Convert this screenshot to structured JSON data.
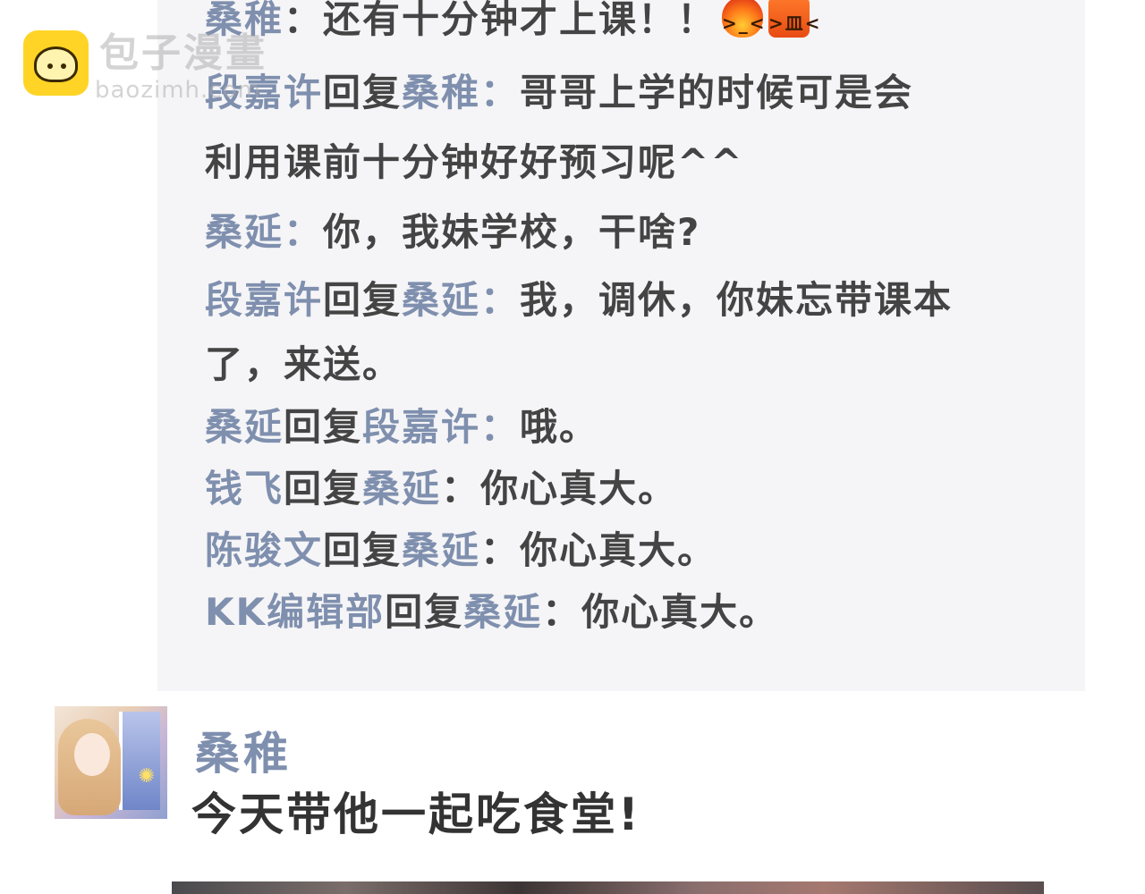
{
  "watermark": {
    "title": "包子漫畫",
    "subtitle": "baozimh.com",
    "icon": "bun-logo-icon"
  },
  "comments": [
    {
      "author": "桑稚",
      "separator": "：",
      "text": "还有十分钟才上课！！",
      "emojis": [
        "fire-angry-emoji",
        "angry-face-emoji"
      ]
    },
    {
      "author": "段嘉许",
      "reply_word": "回复",
      "reply_to": "桑稚：",
      "text": "哥哥上学的时候可是会",
      "text_cont": "利用课前十分钟好好预习呢^^"
    },
    {
      "author": "桑延：",
      "text": "你，我妹学校，干啥?"
    },
    {
      "author": "段嘉许",
      "reply_word": "回复",
      "reply_to": "桑延：",
      "text": "我，调休，你妹忘带课本",
      "text_cont": "了，来送。"
    },
    {
      "author": "桑延",
      "reply_word": "回复",
      "reply_to": "段嘉许：",
      "text": "哦。"
    },
    {
      "author": "钱飞",
      "reply_word": "回复",
      "reply_to": "桑延",
      "separator": "：",
      "text": "你心真大。"
    },
    {
      "author": "陈骏文",
      "reply_word": "回复",
      "reply_to": "桑延",
      "separator": "：",
      "text": "你心真大。"
    },
    {
      "author": "KK编辑部",
      "reply_word": "回复",
      "reply_to": "桑延",
      "separator": "：",
      "text": "你心真大。"
    }
  ],
  "post": {
    "author": "桑稚",
    "text": "今天带他一起吃食堂!"
  },
  "colors": {
    "panel_bg": "#f5f5f7",
    "name": "#7f8fae",
    "text": "#444444"
  }
}
